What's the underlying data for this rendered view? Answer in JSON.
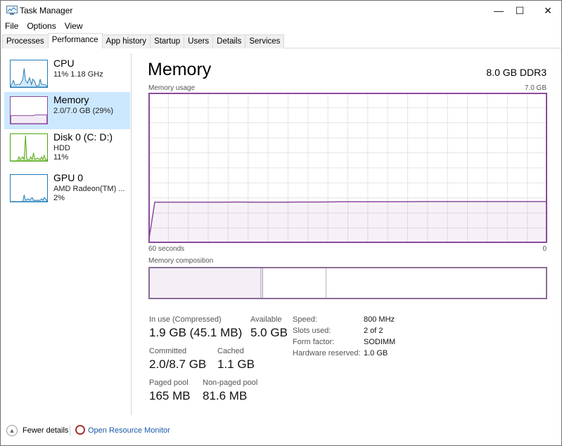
{
  "window": {
    "title": "Task Manager",
    "controls": {
      "minimize": "—",
      "maximize": "☐",
      "close": "✕"
    }
  },
  "menu": [
    "File",
    "Options",
    "View"
  ],
  "tabs": [
    {
      "label": "Processes",
      "active": false
    },
    {
      "label": "Performance",
      "active": true
    },
    {
      "label": "App history",
      "active": false
    },
    {
      "label": "Startup",
      "active": false
    },
    {
      "label": "Users",
      "active": false
    },
    {
      "label": "Details",
      "active": false
    },
    {
      "label": "Services",
      "active": false
    }
  ],
  "sidebar": {
    "items": [
      {
        "title": "CPU",
        "line1": "11%  1.18 GHz",
        "line2": "",
        "color": "#1e7ab8"
      },
      {
        "title": "Memory",
        "line1": "2.0/7.0 GB (29%)",
        "line2": "",
        "color": "#8b4a9c"
      },
      {
        "title": "Disk 0 (C: D:)",
        "line1": "HDD",
        "line2": "11%",
        "color": "#4da60c"
      },
      {
        "title": "GPU 0",
        "line1": "AMD Radeon(TM) ...",
        "line2": "2%",
        "color": "#1e7ab8"
      }
    ]
  },
  "main": {
    "title": "Memory",
    "spec": "8.0 GB DDR3",
    "usage_label": "Memory usage",
    "usage_max": "7.0 GB",
    "time_left": "60 seconds",
    "time_right": "0",
    "composition_label": "Memory composition",
    "composition": {
      "in_use_fraction": 0.28,
      "modified_fraction": 0.006,
      "standby_fraction": 0.16
    },
    "usage_series_gb": [
      0,
      1.9,
      1.9,
      1.9,
      1.9,
      1.91,
      1.9,
      1.9,
      1.91,
      1.91,
      1.92,
      1.92,
      1.92,
      1.92,
      1.93,
      1.93,
      1.93,
      1.93,
      1.93,
      1.93,
      1.93
    ]
  },
  "stats": {
    "in_use": {
      "label": "In use (Compressed)",
      "value": "1.9 GB (45.1 MB)"
    },
    "available": {
      "label": "Available",
      "value": "5.0 GB"
    },
    "committed": {
      "label": "Committed",
      "value": "2.0/8.7 GB"
    },
    "cached": {
      "label": "Cached",
      "value": "1.1 GB"
    },
    "paged": {
      "label": "Paged pool",
      "value": "165 MB"
    },
    "nonpaged": {
      "label": "Non-paged pool",
      "value": "81.6 MB"
    }
  },
  "specs": [
    {
      "key": "Speed:",
      "value": "800 MHz"
    },
    {
      "key": "Slots used:",
      "value": "2 of 2"
    },
    {
      "key": "Form factor:",
      "value": "SODIMM"
    },
    {
      "key": "Hardware reserved:",
      "value": "1.0 GB"
    }
  ],
  "footer": {
    "fewer": "Fewer details",
    "resource_monitor": "Open Resource Monitor"
  }
}
